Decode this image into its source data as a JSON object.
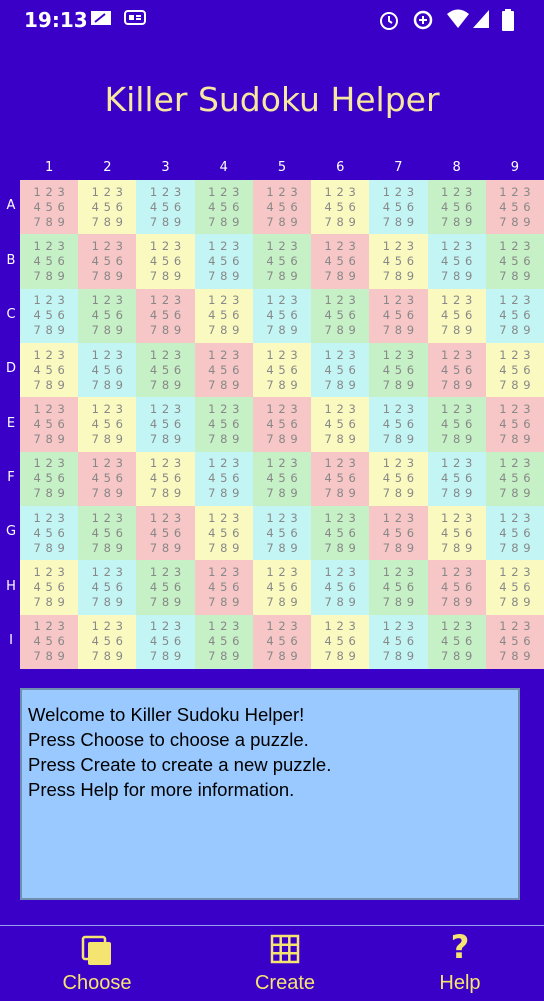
{
  "status_bar": {
    "time": "19:13",
    "icons": [
      "nfc-icon",
      "sim-message-icon",
      "alarm-icon",
      "data-saver-icon",
      "wifi-icon",
      "signal-icon",
      "battery-icon"
    ]
  },
  "app": {
    "title": "Killer Sudoku Helper"
  },
  "grid": {
    "column_labels": [
      "1",
      "2",
      "3",
      "4",
      "5",
      "6",
      "7",
      "8",
      "9"
    ],
    "row_labels": [
      "A",
      "B",
      "C",
      "D",
      "E",
      "F",
      "G",
      "H",
      "I"
    ],
    "candidates": [
      "1",
      "2",
      "3",
      "4",
      "5",
      "6",
      "7",
      "8",
      "9"
    ],
    "colors": {
      "red": "#f7c6c6",
      "yellow": "#fafac0",
      "cyan": "#c3f5f5",
      "green": "#c6f0c6"
    }
  },
  "message_box": {
    "lines": [
      "Welcome to Killer Sudoku Helper!",
      "Press Choose to choose a puzzle.",
      "Press Create to create a new puzzle.",
      "Press Help for more information."
    ]
  },
  "bottom_nav": {
    "choose_label": "Choose",
    "create_label": "Create",
    "help_label": "Help",
    "accent_color": "#f5e470"
  }
}
